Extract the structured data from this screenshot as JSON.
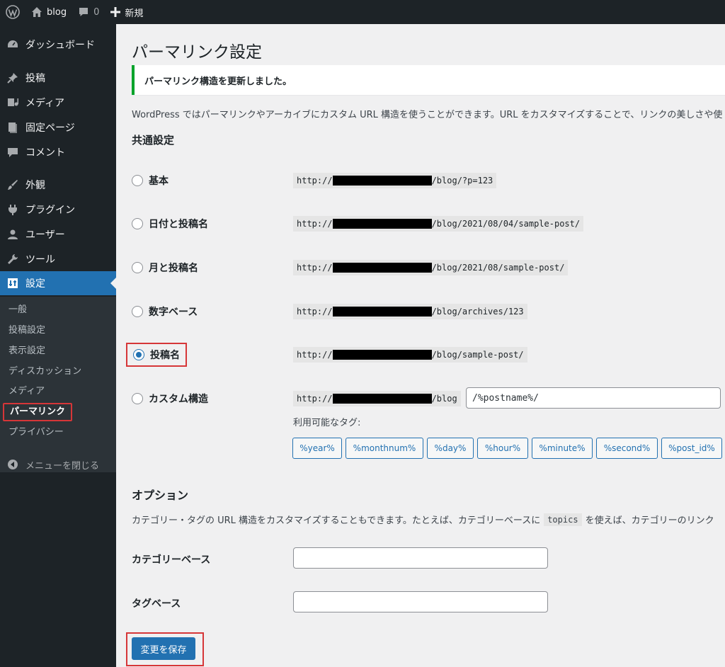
{
  "adminbar": {
    "site_name": "blog",
    "comments_count": "0",
    "new_label": "新規"
  },
  "sidebar": {
    "items": [
      {
        "label": "ダッシュボード",
        "icon": "dashboard-icon"
      },
      {
        "label": "投稿",
        "icon": "pin-icon"
      },
      {
        "label": "メディア",
        "icon": "media-icon"
      },
      {
        "label": "固定ページ",
        "icon": "page-icon"
      },
      {
        "label": "コメント",
        "icon": "comment-icon"
      },
      {
        "label": "外観",
        "icon": "brush-icon"
      },
      {
        "label": "プラグイン",
        "icon": "plugin-icon"
      },
      {
        "label": "ユーザー",
        "icon": "user-icon"
      },
      {
        "label": "ツール",
        "icon": "wrench-icon"
      },
      {
        "label": "設定",
        "icon": "settings-icon"
      }
    ],
    "submenu": [
      "一般",
      "投稿設定",
      "表示設定",
      "ディスカッション",
      "メディア",
      "パーマリンク",
      "プライバシー"
    ],
    "collapse_label": "メニューを閉じる"
  },
  "page": {
    "title": "パーマリンク設定",
    "notice": "パーマリンク構造を更新しました。",
    "intro": "WordPress ではパーマリンクやアーカイブにカスタム URL 構造を使うことができます。URL をカスタマイズすることで、リンクの美しさや使",
    "common_heading": "共通設定"
  },
  "permalink_options": [
    {
      "label": "基本",
      "url_prefix": "http://",
      "url_suffix": "/blog/?p=123",
      "checked": false
    },
    {
      "label": "日付と投稿名",
      "url_prefix": "http://",
      "url_suffix": "/blog/2021/08/04/sample-post/",
      "checked": false
    },
    {
      "label": "月と投稿名",
      "url_prefix": "http://",
      "url_suffix": "/blog/2021/08/sample-post/",
      "checked": false
    },
    {
      "label": "数字ベース",
      "url_prefix": "http://",
      "url_suffix": "/blog/archives/123",
      "checked": false
    },
    {
      "label": "投稿名",
      "url_prefix": "http://",
      "url_suffix": "/blog/sample-post/",
      "checked": true
    },
    {
      "label": "カスタム構造",
      "url_prefix": "http://",
      "url_suffix": "/blog",
      "checked": false
    }
  ],
  "custom": {
    "structure_value": "/%postname%/",
    "tags_label": "利用可能なタグ:",
    "tags": [
      "%year%",
      "%monthnum%",
      "%day%",
      "%hour%",
      "%minute%",
      "%second%",
      "%post_id%"
    ]
  },
  "options": {
    "heading": "オプション",
    "desc_before": "カテゴリー・タグの URL 構造をカスタマイズすることもできます。たとえば、カテゴリーベースに",
    "desc_code": "topics",
    "desc_after": "を使えば、カテゴリーのリンク",
    "category_base_label": "カテゴリーベース",
    "tag_base_label": "タグベース"
  },
  "save_label": "変更を保存",
  "colors": {
    "accent": "#2271b1",
    "success": "#00a32a",
    "highlight": "#d63638"
  }
}
